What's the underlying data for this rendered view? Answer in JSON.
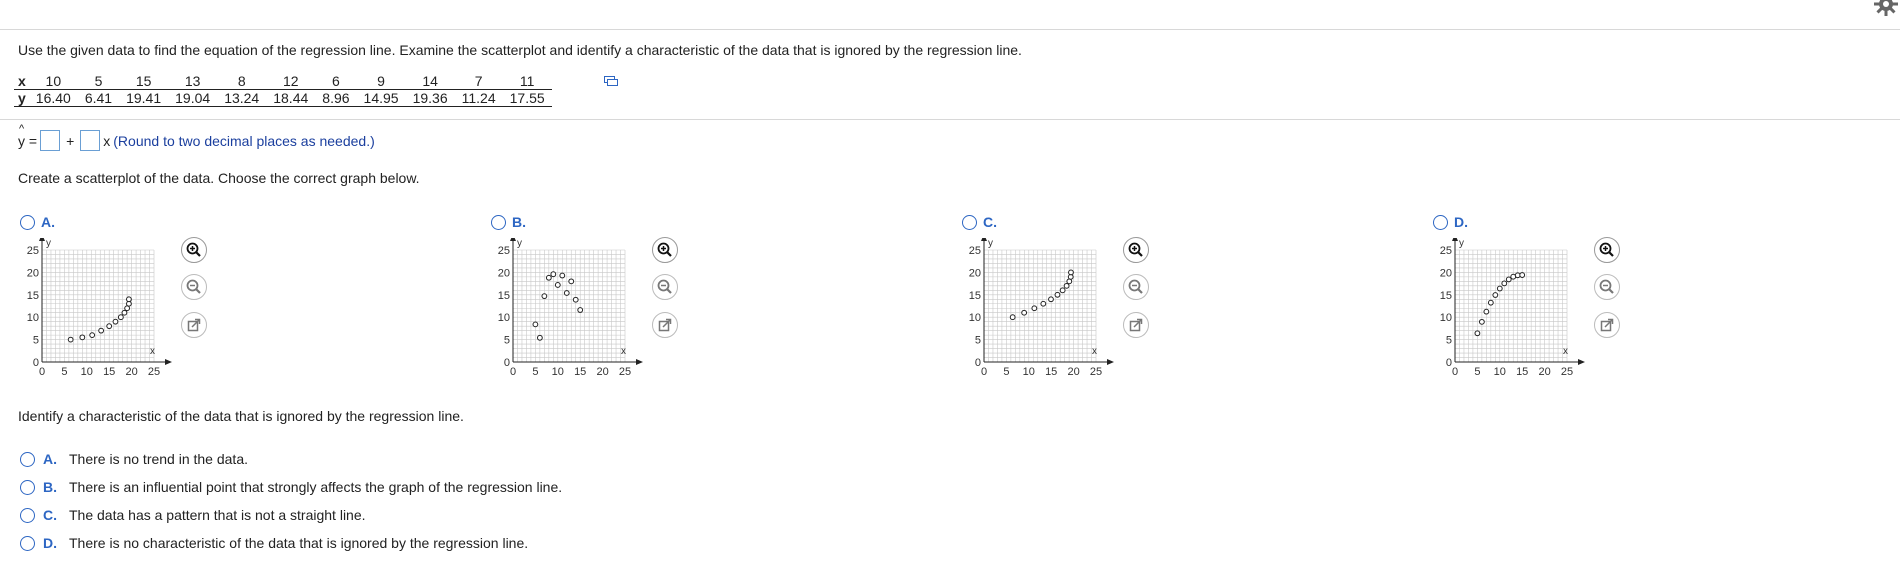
{
  "instructions": "Use the given data to find the equation of the regression line. Examine the scatterplot and identify a characteristic of the data that is ignored by the regression line.",
  "table": {
    "x_label": "x",
    "y_label": "y",
    "x_values": [
      "10",
      "5",
      "15",
      "13",
      "8",
      "12",
      "6",
      "9",
      "14",
      "7",
      "11"
    ],
    "y_values": [
      "16.40",
      "6.41",
      "19.41",
      "19.04",
      "13.24",
      "18.44",
      "8.96",
      "14.95",
      "19.36",
      "11.24",
      "17.55"
    ]
  },
  "equation": {
    "lhs": "y =",
    "plus": "+",
    "x": "x",
    "hint": "(Round to two decimal places as needed.)"
  },
  "scatter_prompt": "Create a scatterplot of the data. Choose the correct graph below.",
  "graph_options": [
    {
      "letter": "A.",
      "selected": false
    },
    {
      "letter": "B.",
      "selected": false
    },
    {
      "letter": "C.",
      "selected": false
    },
    {
      "letter": "D.",
      "selected": false
    }
  ],
  "chart_data": [
    {
      "type": "scatter",
      "option": "A.",
      "xlabel": "x",
      "ylabel": "y",
      "xlim": [
        0,
        25
      ],
      "ylim": [
        0,
        25
      ],
      "xticks": [
        "0",
        "5",
        "10",
        "15",
        "20",
        "25"
      ],
      "yticks": [
        "0",
        "5",
        "10",
        "15",
        "20",
        "25"
      ],
      "grid": true,
      "points": [
        [
          6.4,
          5
        ],
        [
          9,
          5.5
        ],
        [
          11.2,
          6
        ],
        [
          13.2,
          7
        ],
        [
          15,
          8
        ],
        [
          16.4,
          9
        ],
        [
          17.6,
          10
        ],
        [
          18.4,
          11
        ],
        [
          19,
          12
        ],
        [
          19.4,
          13
        ],
        [
          19.4,
          14
        ]
      ]
    },
    {
      "type": "scatter",
      "option": "B.",
      "xlabel": "x",
      "ylabel": "y",
      "xlim": [
        0,
        25
      ],
      "ylim": [
        0,
        25
      ],
      "xticks": [
        "0",
        "5",
        "10",
        "15",
        "20",
        "25"
      ],
      "yticks": [
        "0",
        "5",
        "10",
        "15",
        "20",
        "25"
      ],
      "grid": true,
      "points": [
        [
          5,
          8.4
        ],
        [
          6,
          5.4
        ],
        [
          7,
          14.7
        ],
        [
          8,
          18.8
        ],
        [
          9,
          19.6
        ],
        [
          10,
          17.2
        ],
        [
          11,
          19.3
        ],
        [
          12,
          15.4
        ],
        [
          13,
          18
        ],
        [
          14,
          13.9
        ],
        [
          15,
          11.6
        ]
      ]
    },
    {
      "type": "scatter",
      "option": "C.",
      "xlabel": "x",
      "ylabel": "y",
      "xlim": [
        0,
        25
      ],
      "ylim": [
        0,
        25
      ],
      "xticks": [
        "0",
        "5",
        "10",
        "15",
        "20",
        "25"
      ],
      "yticks": [
        "0",
        "5",
        "10",
        "15",
        "20",
        "25"
      ],
      "grid": true,
      "points": [
        [
          6.4,
          10
        ],
        [
          8.96,
          11
        ],
        [
          11.24,
          12
        ],
        [
          13.24,
          13
        ],
        [
          14.95,
          14
        ],
        [
          16.4,
          15
        ],
        [
          17.55,
          16
        ],
        [
          18.44,
          17
        ],
        [
          19.04,
          18
        ],
        [
          19.36,
          19
        ],
        [
          19.41,
          20
        ]
      ]
    },
    {
      "type": "scatter",
      "option": "D.",
      "xlabel": "x",
      "ylabel": "y",
      "xlim": [
        0,
        25
      ],
      "ylim": [
        0,
        25
      ],
      "xticks": [
        "0",
        "5",
        "10",
        "15",
        "20",
        "25"
      ],
      "yticks": [
        "0",
        "5",
        "10",
        "15",
        "20",
        "25"
      ],
      "grid": true,
      "points": [
        [
          5,
          6.41
        ],
        [
          6,
          8.96
        ],
        [
          7,
          11.24
        ],
        [
          8,
          13.24
        ],
        [
          9,
          14.95
        ],
        [
          10,
          16.4
        ],
        [
          11,
          17.55
        ],
        [
          12,
          18.44
        ],
        [
          13,
          19.04
        ],
        [
          14,
          19.36
        ],
        [
          15,
          19.41
        ]
      ]
    }
  ],
  "characteristic_prompt": "Identify a characteristic of the data that is ignored by the regression line.",
  "choices": [
    {
      "letter": "A.",
      "text": "There is no trend in the data."
    },
    {
      "letter": "B.",
      "text": "There is an influential point that strongly affects the graph of the regression line."
    },
    {
      "letter": "C.",
      "text": "The data has a pattern that is not a straight line."
    },
    {
      "letter": "D.",
      "text": "There is no characteristic of the data that is ignored by the regression line."
    }
  ],
  "colors": {
    "accent": "#2d66c3",
    "hint": "#1b3f9e",
    "input_border": "#6a9fd4",
    "grid": "#c8c8c8"
  },
  "icons": [
    "gear-icon",
    "copy-data-icon",
    "zoom-in-icon",
    "zoom-out-icon",
    "open-window-icon"
  ]
}
